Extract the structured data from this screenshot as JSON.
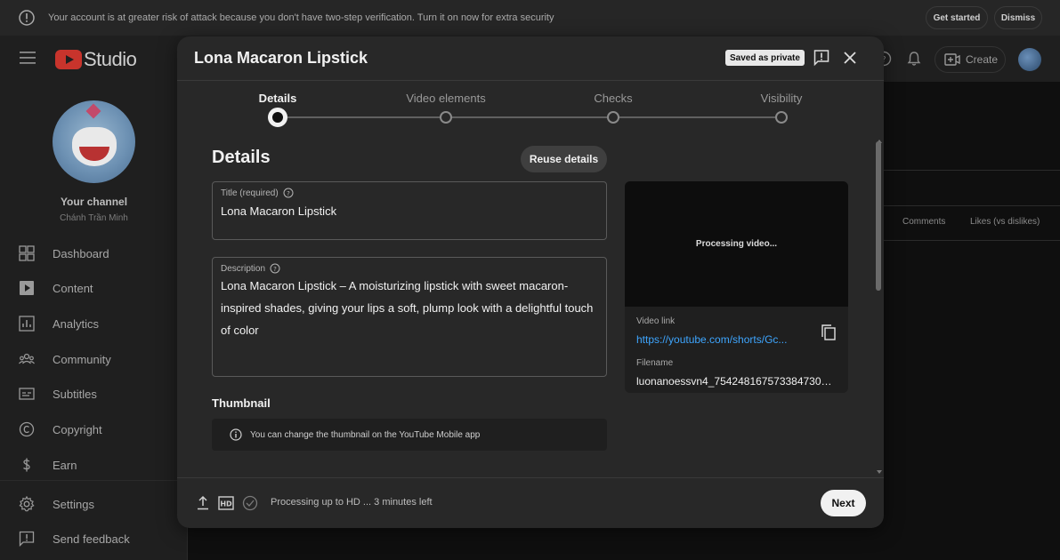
{
  "banner": {
    "message": "Your account is at greater risk of attack because you don't have two-step verification. Turn it on now for extra security",
    "get_started": "Get started",
    "dismiss": "Dismiss"
  },
  "header": {
    "logo_text": "Studio",
    "create_label": "Create"
  },
  "sidebar": {
    "channel_title": "Your channel",
    "channel_name": "Chánh Trần Minh",
    "items": [
      {
        "label": "Dashboard",
        "icon": "dashboard-icon"
      },
      {
        "label": "Content",
        "icon": "content-icon"
      },
      {
        "label": "Analytics",
        "icon": "analytics-icon"
      },
      {
        "label": "Community",
        "icon": "community-icon"
      },
      {
        "label": "Subtitles",
        "icon": "subtitles-icon"
      },
      {
        "label": "Copyright",
        "icon": "copyright-icon"
      },
      {
        "label": "Earn",
        "icon": "earn-icon"
      },
      {
        "label": "Settings",
        "icon": "settings-icon"
      },
      {
        "label": "Send feedback",
        "icon": "feedback-icon"
      }
    ]
  },
  "background_table": {
    "columns": [
      "Comments",
      "Likes (vs dislikes)"
    ]
  },
  "modal": {
    "title": "Lona Macaron Lipstick",
    "saved_badge": "Saved as private",
    "steps": [
      {
        "label": "Details",
        "active": true
      },
      {
        "label": "Video elements",
        "active": false
      },
      {
        "label": "Checks",
        "active": false
      },
      {
        "label": "Visibility",
        "active": false
      }
    ],
    "section_title": "Details",
    "reuse_label": "Reuse details",
    "title_field": {
      "label": "Title (required)",
      "value": "Lona Macaron Lipstick"
    },
    "description_field": {
      "label": "Description",
      "value": "Lona Macaron Lipstick – A moisturizing lipstick with sweet macaron-inspired shades, giving your lips a soft, plump look with a delightful touch of color"
    },
    "thumbnail": {
      "title": "Thumbnail",
      "note": "You can change the thumbnail on the YouTube Mobile app"
    },
    "preview": {
      "processing_text": "Processing video...",
      "video_link_label": "Video link",
      "video_link": "https://youtube.com/shorts/Gc...",
      "filename_label": "Filename",
      "filename": "luonanoessvn4_7542481675733847302..."
    },
    "footer": {
      "status": "Processing up to HD ... 3 minutes left",
      "next_label": "Next"
    }
  },
  "colors": {
    "accent_link": "#3ea6ff",
    "brand_red": "#c8342c",
    "modal_bg": "#282828"
  }
}
